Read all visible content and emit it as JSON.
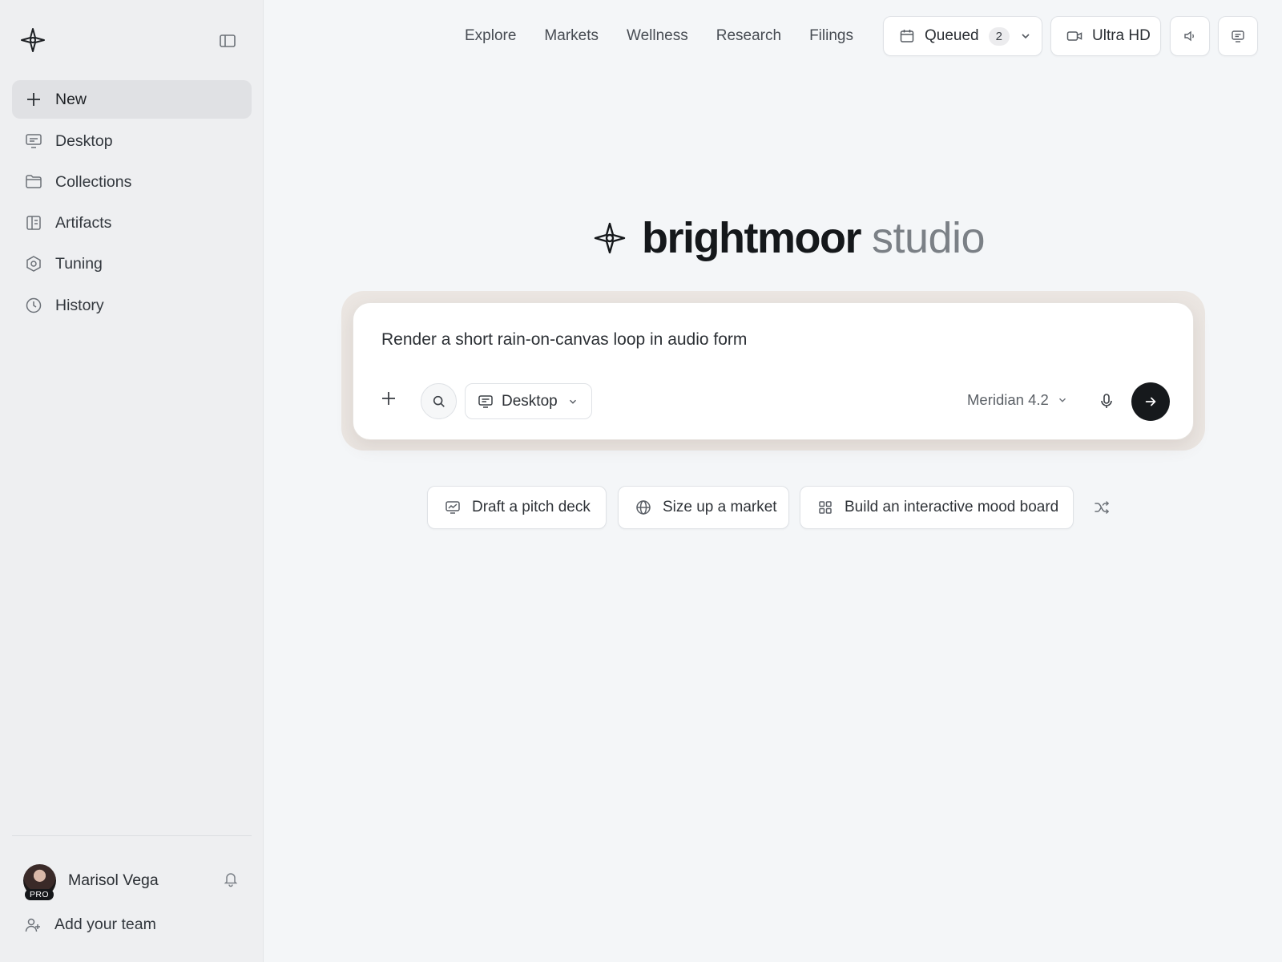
{
  "sidebar": {
    "items": [
      {
        "label": "New",
        "icon": "plus-icon"
      },
      {
        "label": "Desktop",
        "icon": "desktop-icon"
      },
      {
        "label": "Collections",
        "icon": "folder-icon"
      },
      {
        "label": "Artifacts",
        "icon": "artifacts-icon"
      },
      {
        "label": "Tuning",
        "icon": "hexagon-gear-icon"
      },
      {
        "label": "History",
        "icon": "clock-icon"
      }
    ],
    "user": {
      "name": "Marisol Vega",
      "badge": "PRO"
    },
    "add_team_label": "Add your team"
  },
  "topnav": {
    "links": [
      "Explore",
      "Markets",
      "Wellness",
      "Research",
      "Filings"
    ],
    "queued_label": "Queued",
    "queued_count": "2",
    "quality_label": "Ultra HD"
  },
  "hero": {
    "brand": "brightmoor",
    "brand_sub": "studio"
  },
  "prompt": {
    "text": "Render a short rain-on-canvas loop in audio form",
    "mode_label": "Desktop",
    "model_label": "Meridian 4.2"
  },
  "suggestions": [
    "Draft a pitch deck",
    "Size up a market",
    "Build an interactive mood board"
  ],
  "colors": {
    "accent": "#16191c",
    "background": "#f4f6f8",
    "sidebar": "#eeeff1"
  }
}
